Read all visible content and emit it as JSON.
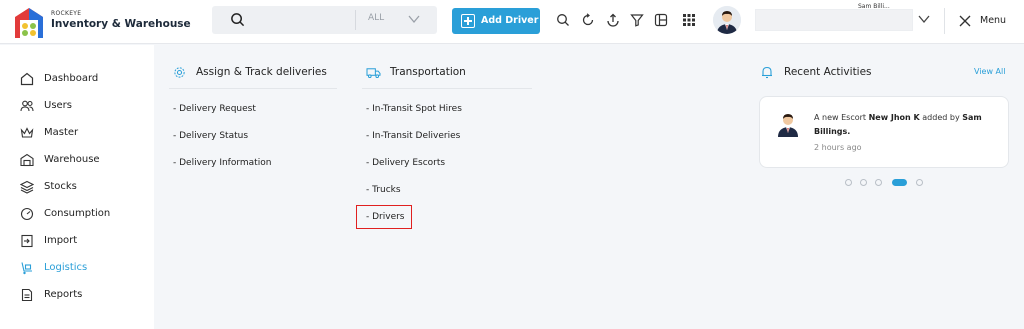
{
  "brand": {
    "company": "ROCKEYE",
    "product": "Inventory & Warehouse"
  },
  "search": {
    "value": "",
    "filter": "ALL"
  },
  "toolbar": {
    "add_label": "Add Driver",
    "icons": [
      "search-icon",
      "refresh-icon",
      "upload-icon",
      "filter-icon",
      "table-icon",
      "grid-icon"
    ],
    "menu_label": "Menu"
  },
  "user": {
    "name": "Sam Billi..."
  },
  "sidebar": {
    "items": [
      {
        "label": "Dashboard",
        "icon": "home-icon"
      },
      {
        "label": "Users",
        "icon": "users-icon"
      },
      {
        "label": "Master",
        "icon": "crown-icon"
      },
      {
        "label": "Warehouse",
        "icon": "warehouse-icon"
      },
      {
        "label": "Stocks",
        "icon": "stack-icon"
      },
      {
        "label": "Consumption",
        "icon": "gauge-icon"
      },
      {
        "label": "Import",
        "icon": "import-icon"
      },
      {
        "label": "Logistics",
        "icon": "logistics-icon",
        "active": true
      },
      {
        "label": "Reports",
        "icon": "report-icon"
      }
    ]
  },
  "sections": {
    "assign": {
      "title": "Assign & Track deliveries",
      "links": [
        "- Delivery Request",
        "- Delivery Status",
        "- Delivery Information"
      ]
    },
    "transport": {
      "title": "Transportation",
      "links": [
        "- In-Transit Spot Hires",
        "- In-Transit Deliveries",
        "- Delivery Escorts",
        "- Trucks",
        "- Drivers"
      ]
    }
  },
  "activities": {
    "title": "Recent Activities",
    "view_all": "View All",
    "item": {
      "prefix": "A new Escort ",
      "subject": "New Jhon K",
      "middle": " added by ",
      "actor": "Sam Billings.",
      "time": "2 hours ago"
    },
    "pager": {
      "count": 5,
      "active": 4
    }
  },
  "colors": {
    "accent": "#2a9fd8",
    "highlight": "#e02020"
  }
}
